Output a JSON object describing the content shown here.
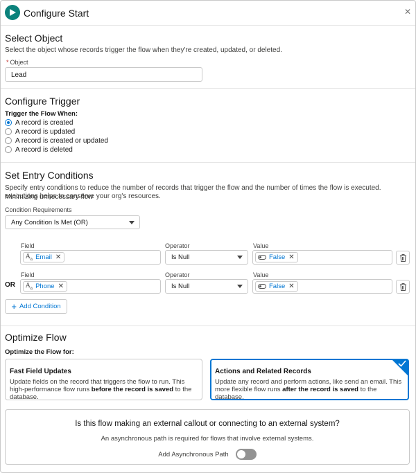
{
  "header": {
    "title": "Configure Start",
    "close_icon": "close-icon",
    "start_icon": "play-icon"
  },
  "select_object": {
    "title": "Select Object",
    "help": "Select the object whose records trigger the flow when they're created, updated, or deleted.",
    "required_mark": "*",
    "object_label": "Object",
    "object_value": "Lead"
  },
  "trigger": {
    "title": "Configure Trigger",
    "when_label": "Trigger the Flow When:",
    "options": [
      {
        "label": "A record is created",
        "checked": true
      },
      {
        "label": "A record is updated",
        "checked": false
      },
      {
        "label": "A record is created or updated",
        "checked": false
      },
      {
        "label": "A record is deleted",
        "checked": false
      }
    ]
  },
  "entry": {
    "title": "Set Entry Conditions",
    "help_line1": "Specify entry conditions to reduce the number of records that trigger the flow and the number of times the flow is executed. Minimizing unnecessary flow",
    "help_line2": "executions helps to conserve your org's resources.",
    "requirements_label": "Condition Requirements",
    "requirements_value": "Any Condition Is Met (OR)",
    "or_label": "OR",
    "add_condition": "Add Condition",
    "conditions": [
      {
        "field_label": "Field",
        "field": "Email",
        "operator_label": "Operator",
        "operator": "Is Null",
        "value_label": "Value",
        "value": "False"
      },
      {
        "field_label": "Field",
        "field": "Phone",
        "operator_label": "Operator",
        "operator": "Is Null",
        "value_label": "Value",
        "value": "False"
      }
    ]
  },
  "optimize": {
    "title": "Optimize Flow",
    "for_label": "Optimize the Flow for:",
    "cards": [
      {
        "title": "Fast Field Updates",
        "text_a": "Update fields on the record that triggers the flow to run. This high-performance flow runs ",
        "text_bold": "before the record is saved",
        "text_b": " to the database.",
        "selected": false
      },
      {
        "title": "Actions and Related Records",
        "text_a": "Update any record and perform actions, like send an email. This more flexible flow runs ",
        "text_bold": "after the record is saved",
        "text_b": " to the database.",
        "selected": true
      }
    ]
  },
  "async": {
    "question": "Is this flow making an external callout or connecting to an external system?",
    "sub": "An asynchronous path is required for flows that involve external systems.",
    "toggle_label": "Add Asynchronous Path",
    "enabled": false
  },
  "colors": {
    "accent": "#0176d3",
    "start_icon": "#0b827c"
  }
}
